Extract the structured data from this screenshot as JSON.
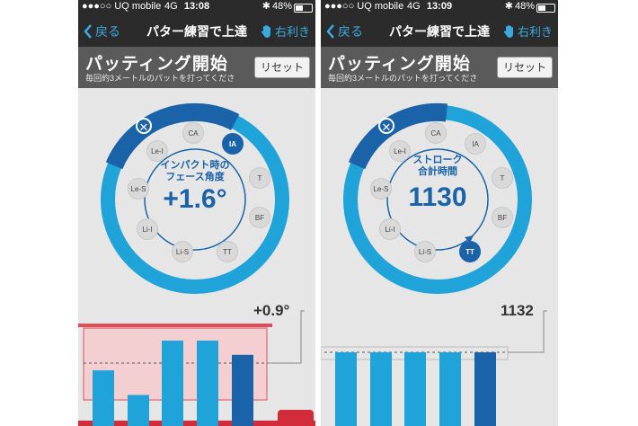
{
  "screens": [
    {
      "status": {
        "carrier": "●●●○○ UQ mobile",
        "network": "4G",
        "time": "13:08",
        "battery": "48%",
        "battery_level": 0.48
      },
      "nav": {
        "back": "戻る",
        "title": "パター練習で上達",
        "hand": "右利き"
      },
      "header": {
        "title": "パッティング開始",
        "subtitle": "毎回約3メートルのパットを打ってくださ",
        "reset": "リセット"
      },
      "ring_nodes": [
        {
          "label": "CA",
          "active": false
        },
        {
          "label": "IA",
          "active": true
        },
        {
          "label": "T",
          "active": false
        },
        {
          "label": "BF",
          "active": false
        },
        {
          "label": "TT",
          "active": false
        },
        {
          "label": "Li-S",
          "active": false
        },
        {
          "label": "Li-I",
          "active": false
        },
        {
          "label": "Le-S",
          "active": false
        },
        {
          "label": "Le-I",
          "active": false
        }
      ],
      "center": {
        "line1": "インパクト時の",
        "line2": "フェース角度",
        "value": "+1.6°"
      },
      "target_value": "+0.9°",
      "bars": [
        0.43,
        0.24,
        0.66,
        0.66,
        0.55
      ],
      "active_bar": 4,
      "band": "red"
    },
    {
      "status": {
        "carrier": "●●●○○ UQ mobile",
        "network": "4G",
        "time": "13:09",
        "battery": "48%",
        "battery_level": 0.48
      },
      "nav": {
        "back": "戻る",
        "title": "パター練習で上達",
        "hand": "右利き"
      },
      "header": {
        "title": "パッティング開始",
        "subtitle": "毎回約3メートルのパットを打ってくださ",
        "reset": "リセット"
      },
      "ring_nodes": [
        {
          "label": "CA",
          "active": false
        },
        {
          "label": "IA",
          "active": false
        },
        {
          "label": "T",
          "active": false
        },
        {
          "label": "BF",
          "active": false
        },
        {
          "label": "TT",
          "active": true
        },
        {
          "label": "Li-S",
          "active": false
        },
        {
          "label": "Li-I",
          "active": false
        },
        {
          "label": "Le-S",
          "active": false
        },
        {
          "label": "Le-I",
          "active": false
        }
      ],
      "center": {
        "line1": "ストローク",
        "line2": "合計時間",
        "value": "1130"
      },
      "target_value": "1132",
      "bars": [
        0.57,
        0.57,
        0.57,
        0.57,
        0.57
      ],
      "active_bar": 4,
      "band": "gray"
    }
  ],
  "colors": {
    "ring_dark": "#1a63a8",
    "ring_light": "#1fa3d8",
    "bar_light": "#1fa3d8",
    "bar_dark": "#1a63a8",
    "band_red": "#f4cfd2",
    "band_red_border": "#d94f5c",
    "band_gray": "#d0d0d0"
  },
  "icons": {
    "back": "chevron-left-icon",
    "hand": "hand-icon",
    "close": "close-icon",
    "flag": "flag-icon"
  }
}
